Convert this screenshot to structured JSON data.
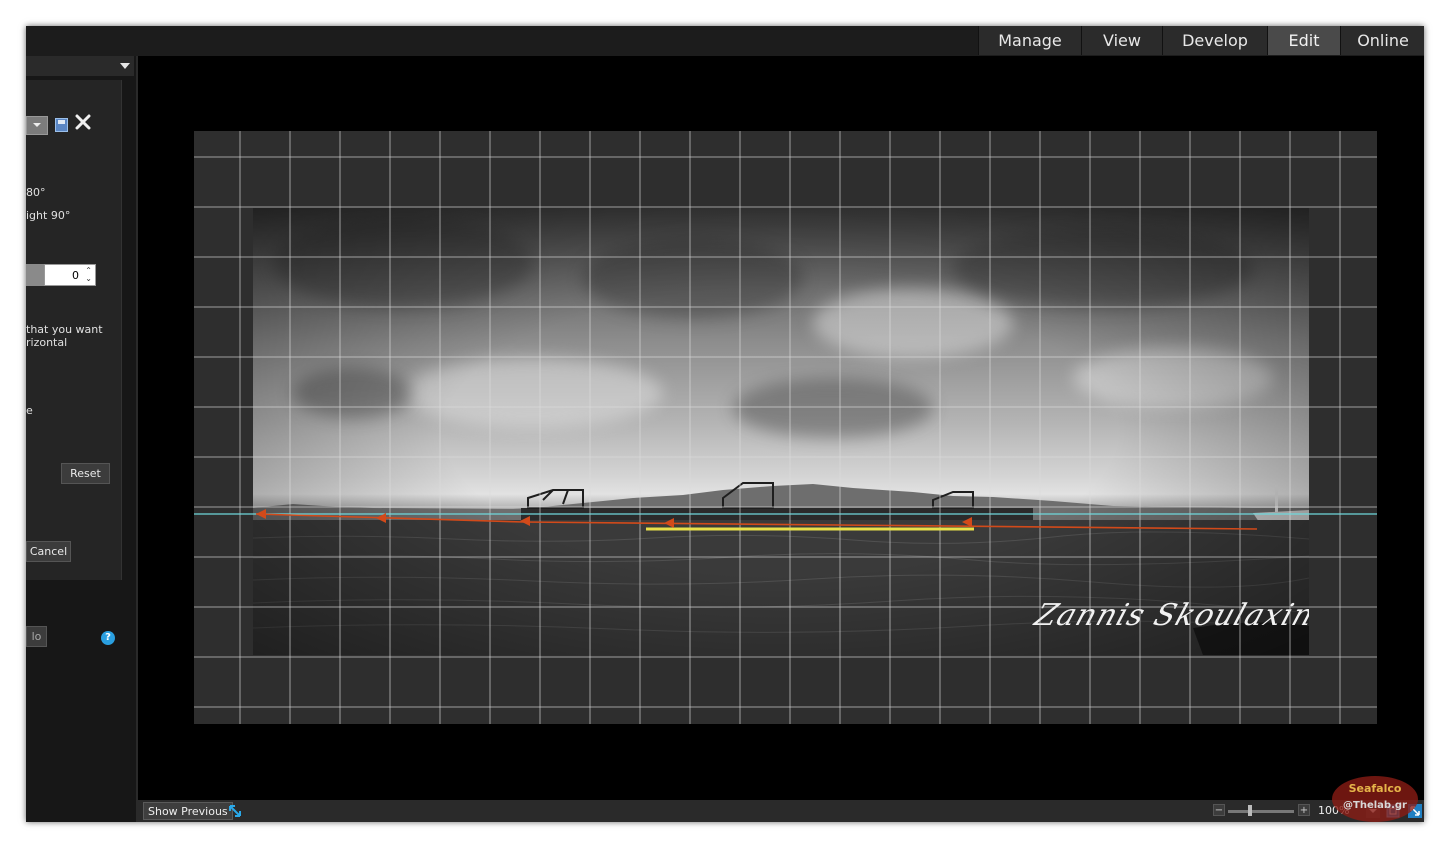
{
  "tabs": [
    {
      "label": "Manage",
      "active": false
    },
    {
      "label": "View",
      "active": false
    },
    {
      "label": "Develop",
      "active": false
    },
    {
      "label": "Edit",
      "active": true
    },
    {
      "label": "Online",
      "active": false
    }
  ],
  "panel": {
    "rotate_180": "80°",
    "rotate_right_90": "ight 90°",
    "angle_value": "0",
    "instruction_line1": " that you want",
    "instruction_line2": "rizontal",
    "option_fragment": "e",
    "reset_label": "Reset",
    "cancel_label": "Cancel",
    "undo_fragment": "lo",
    "help_glyph": "?"
  },
  "photo": {
    "signature": "Zannis Skoulaxinos"
  },
  "statusbar": {
    "show_previous_label": "Show Previous",
    "zoom_minus": "−",
    "zoom_plus": "+",
    "zoom_value": "100%"
  },
  "watermark": {
    "line1": "Seafalco",
    "line2": "@Thelab.gr"
  },
  "colors": {
    "active_tab": "#4a4a4a",
    "horizon_line": "#6fd8dc",
    "reference_line": "#e8e04a",
    "drag_arrow": "#d24a1a",
    "help_icon": "#2a9fe0"
  }
}
